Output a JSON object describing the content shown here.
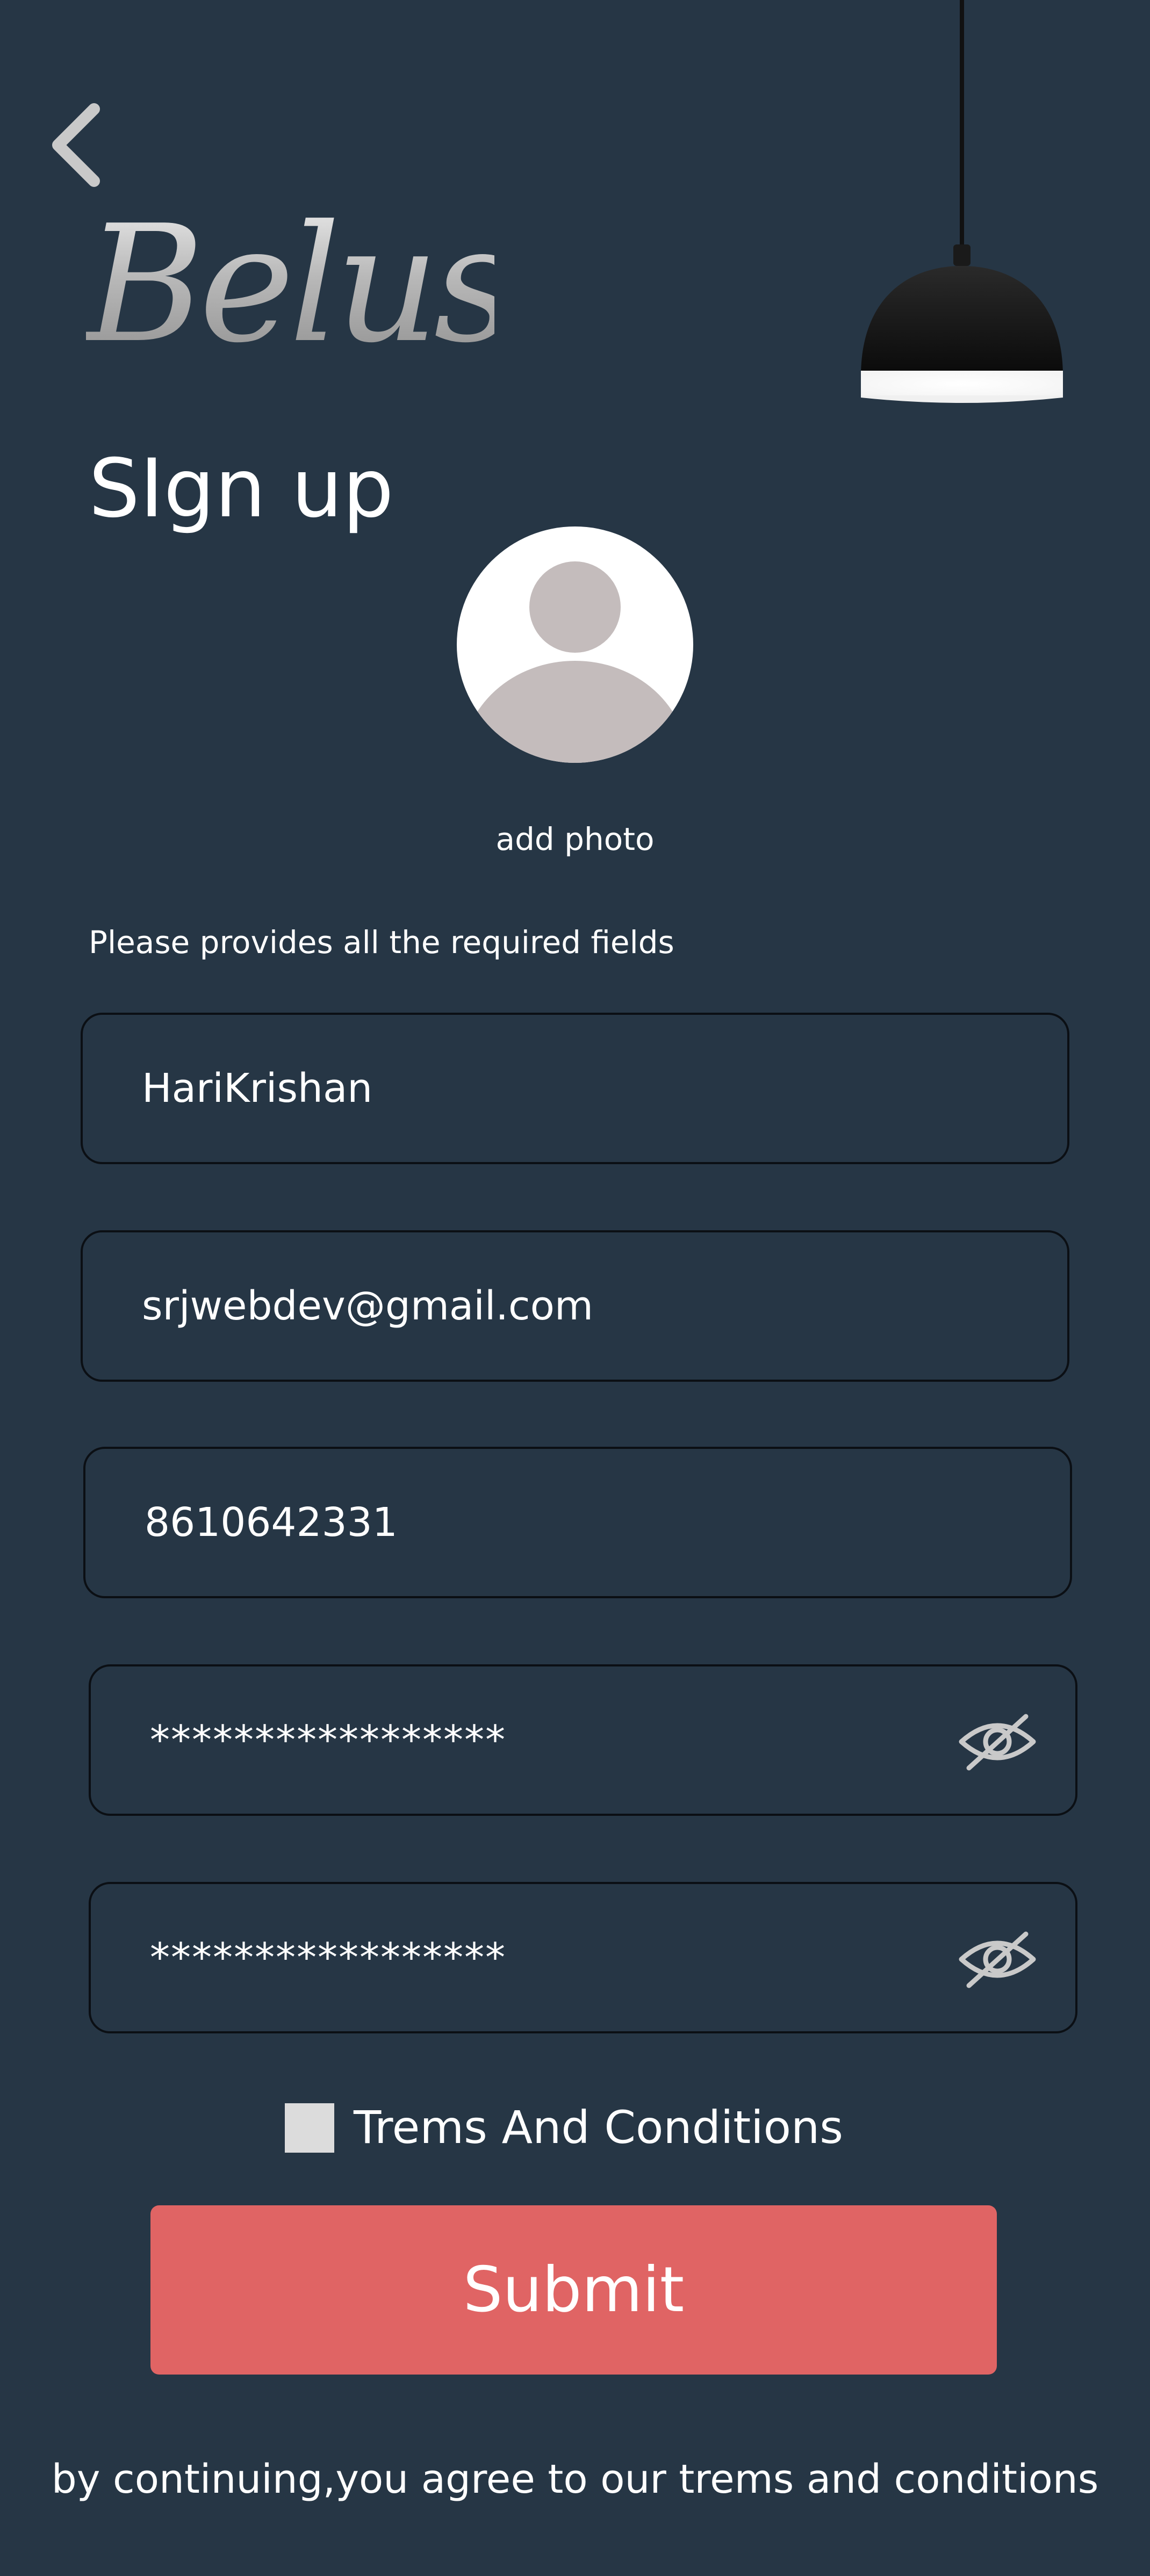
{
  "header": {
    "back_icon": "chevron-left-icon",
    "logo_text": "Belus",
    "lamp_icon": "pendant-lamp-icon"
  },
  "page": {
    "title": "SIgn up",
    "avatar_icon": "user-placeholder-icon",
    "add_photo_label": "add photo",
    "required_note": "Please provides all the required fields"
  },
  "form": {
    "name_value": "HariKrishan",
    "email_value": "srjwebdev@gmail.com",
    "phone_value": "8610642331",
    "password_value": "*****************",
    "confirm_password_value": "*****************",
    "eye_icon": "eye-off-icon",
    "terms_label": "Trems And Conditions",
    "terms_checked": false,
    "submit_label": "Submit"
  },
  "footer": {
    "note": "by continuing,you agree to our trems and conditions"
  },
  "colors": {
    "background": "#263645",
    "submit": "#e06464",
    "avatar_fill": "#c4bcbc",
    "checkbox": "#dcdcdc"
  }
}
